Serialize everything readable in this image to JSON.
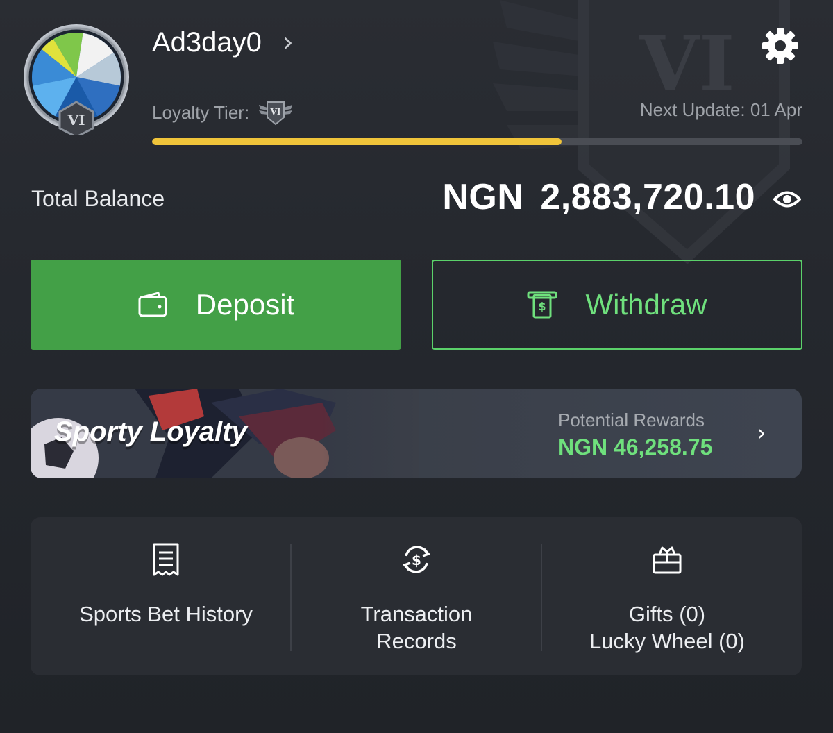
{
  "profile": {
    "username": "Ad3day0",
    "avatar_badge": "VI",
    "loyalty_tier_label": "Loyalty Tier:",
    "tier_badge": "VI",
    "next_update": "Next Update: 01 Apr",
    "tier_progress_percent": 63
  },
  "background_emblem_text": "VI",
  "balance": {
    "label": "Total Balance",
    "currency": "NGN",
    "amount": "2,883,720.10"
  },
  "actions": {
    "deposit": "Deposit",
    "withdraw": "Withdraw"
  },
  "loyalty": {
    "title": "Sporty Loyalty",
    "rewards_label": "Potential Rewards",
    "rewards_value": "NGN 46,258.75"
  },
  "quick_links": [
    {
      "label": "Sports Bet History",
      "icon": "receipt-icon"
    },
    {
      "label": "Transaction Records",
      "icon": "currency-exchange-icon"
    },
    {
      "label_line1": "Gifts (0)",
      "label_line2": "Lucky Wheel (0)",
      "icon": "gift-icon"
    }
  ],
  "colors": {
    "accent_green": "#43a047",
    "highlight_green": "#6fe07d",
    "progress_yellow": "#f0c43a",
    "background": "#25282e"
  }
}
